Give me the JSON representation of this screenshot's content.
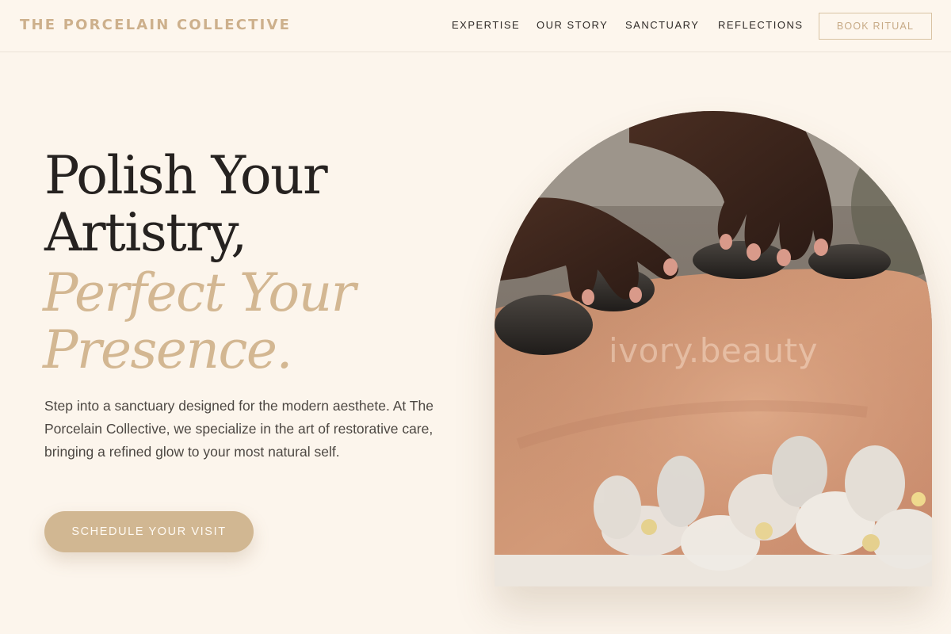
{
  "brand": "THE PORCELAIN COLLECTIVE",
  "nav": [
    "EXPERTISE",
    "OUR STORY",
    "SANCTUARY",
    "REFLECTIONS"
  ],
  "book_button": "BOOK RITUAL",
  "hero": {
    "title_line1": "Polish Your",
    "title_line2": "Artistry,",
    "title_italic_line1": "Perfect Your",
    "title_italic_line2": "Presence.",
    "description": "Step into a sanctuary designed for the modern aesthete. At The Porcelain Collective, we specialize in the art of restorative care, bringing a refined glow to your most natural self.",
    "cta": "SCHEDULE YOUR VISIT"
  },
  "image": {
    "watermark": "ivory.beauty"
  },
  "colors": {
    "background": "#fcf5ec",
    "accent": "#d1b792",
    "brand": "#cdb08c",
    "text": "#262220"
  }
}
